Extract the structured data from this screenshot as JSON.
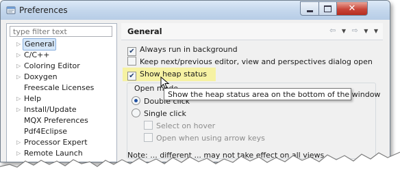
{
  "window": {
    "title": "Preferences",
    "buttons": {
      "minimize": "minimize-icon",
      "maximize": "maximize-icon",
      "close": "close-icon"
    }
  },
  "filter": {
    "placeholder": "type filter text",
    "value": ""
  },
  "tree": [
    {
      "label": "General",
      "has_children": true,
      "selected": true
    },
    {
      "label": "C/C++",
      "has_children": true
    },
    {
      "label": "Coloring Editor",
      "has_children": true
    },
    {
      "label": "Doxygen",
      "has_children": true
    },
    {
      "label": "Freescale Licenses",
      "has_children": false
    },
    {
      "label": "Help",
      "has_children": true
    },
    {
      "label": "Install/Update",
      "has_children": true
    },
    {
      "label": "MQX Preferences",
      "has_children": false
    },
    {
      "label": "Pdf4Eclipse",
      "has_children": false
    },
    {
      "label": "Processor Expert",
      "has_children": true
    },
    {
      "label": "Remote Launch",
      "has_children": true
    }
  ],
  "page": {
    "title": "General",
    "nav": {
      "back_icon": "back-arrow-icon",
      "forward_icon": "forward-arrow-icon",
      "menu_icon": "chevron-down-icon"
    },
    "options": {
      "always_background": {
        "label": "Always run in background",
        "checked": true
      },
      "keep_next_prev": {
        "label": "Keep next/previous editor, view and perspectives dialog open",
        "checked": false
      },
      "show_heap": {
        "label": "Show heap status",
        "checked": true
      }
    },
    "open_mode": {
      "title": "Open mode",
      "double_click": {
        "label": "Double click",
        "selected": true
      },
      "single_click": {
        "label": "Single click",
        "selected": false
      },
      "select_on_hover": {
        "label": "Select on hover",
        "checked": false,
        "enabled": false
      },
      "open_with_arrows": {
        "label": "Open when using arrow keys",
        "checked": false,
        "enabled": false
      }
    },
    "note": "Note: ... different ... may not take effect on all views"
  },
  "tooltip": {
    "text": "Show the heap status area on the bottom of the window"
  },
  "colors": {
    "highlight": "#f6f29a",
    "selection": "#d5e6f8",
    "title_gradient": "#c3d6ec"
  }
}
